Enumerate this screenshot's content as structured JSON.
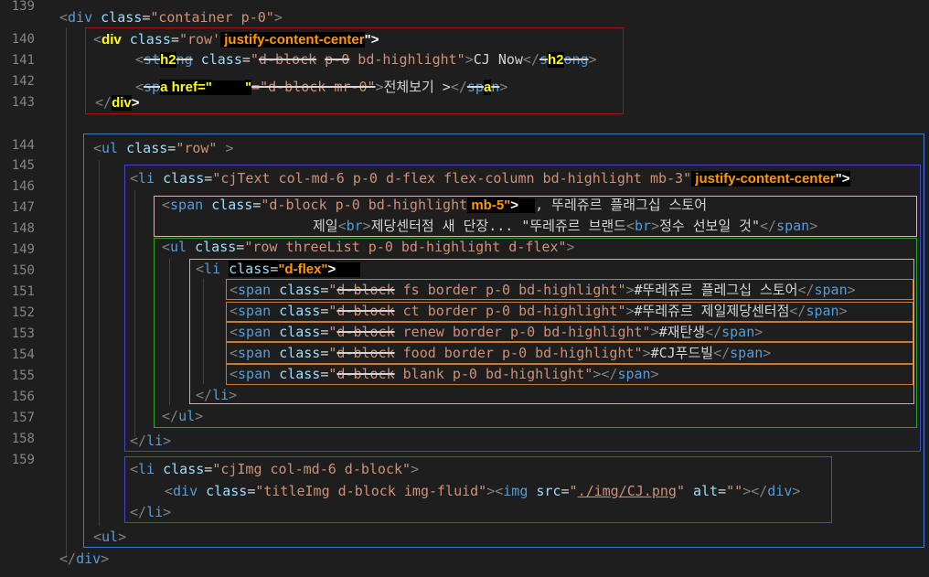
{
  "editor": {
    "line_numbers": [
      "139",
      "140",
      "141",
      "142",
      "143",
      "144",
      "145",
      "146",
      "147",
      "148",
      "149",
      "150",
      "151",
      "152",
      "153",
      "154",
      "155",
      "156",
      "157",
      "158",
      "159"
    ],
    "lines": [
      {
        "tokens": [
          {
            "t": "<",
            "c": "punct"
          },
          {
            "t": "div",
            "c": "tag"
          },
          {
            "t": " ",
            "c": "text"
          },
          {
            "t": "class",
            "c": "attr"
          },
          {
            "t": "=",
            "c": "eq"
          },
          {
            "t": "\"container p-0\"",
            "c": "str"
          },
          {
            "t": ">",
            "c": "punct"
          }
        ]
      },
      {
        "tokens": [
          {
            "t": "<",
            "c": "punct"
          },
          {
            "t": "div",
            "c": "hl-yellow"
          },
          {
            "t": " ",
            "c": "text"
          },
          {
            "t": "class",
            "c": "attr"
          },
          {
            "t": "=",
            "c": "eq"
          },
          {
            "t": "\"row'",
            "c": "str"
          },
          {
            "t": " justify-content-center",
            "c": "hl-orange blackbg"
          },
          {
            "t": "\">",
            "c": "hl-white"
          }
        ]
      },
      {
        "tokens": [
          {
            "t": "<",
            "c": "punct"
          },
          {
            "t": "st",
            "c": "tag strike"
          },
          {
            "t": "h2",
            "c": "hl-yellow blackbg"
          },
          {
            "t": "ng",
            "c": "tag strike"
          },
          {
            "t": " ",
            "c": "text"
          },
          {
            "t": "class",
            "c": "attr"
          },
          {
            "t": "=",
            "c": "eq"
          },
          {
            "t": "\"",
            "c": "str"
          },
          {
            "t": "d-block",
            "c": "str strike"
          },
          {
            "t": " ",
            "c": "str"
          },
          {
            "t": "p-0",
            "c": "str strike"
          },
          {
            "t": " bd-highlight\"",
            "c": "str"
          },
          {
            "t": ">",
            "c": "punct"
          },
          {
            "t": "CJ Now",
            "c": "text"
          },
          {
            "t": "</",
            "c": "punct"
          },
          {
            "t": "s",
            "c": "tag strike"
          },
          {
            "t": "h2",
            "c": "hl-yellow blackbg"
          },
          {
            "t": "ong",
            "c": "tag strike"
          },
          {
            "t": ">",
            "c": "punct"
          }
        ]
      },
      {
        "tokens": [
          {
            "t": "<",
            "c": "punct"
          },
          {
            "t": "sp",
            "c": "tag strike"
          },
          {
            "t": "a href=\"",
            "c": "hl-yellow blackbg"
          },
          {
            "t": "    ",
            "c": "redact"
          },
          {
            "t": "\"",
            "c": "hl-yellow blackbg"
          },
          {
            "t": "=\"d-block mr-0\"",
            "c": "str strike"
          },
          {
            "t": ">",
            "c": "punct"
          },
          {
            "t": "전체보기 >",
            "c": "text"
          },
          {
            "t": "</",
            "c": "punct"
          },
          {
            "t": "sp",
            "c": "tag strike"
          },
          {
            "t": "a",
            "c": "hl-yellow blackbg"
          },
          {
            "t": "n",
            "c": "tag strike"
          },
          {
            "t": ">",
            "c": "punct"
          }
        ]
      },
      {
        "tokens": [
          {
            "t": "</",
            "c": "punct"
          },
          {
            "t": "div",
            "c": "hl-yellow blackbg"
          },
          {
            "t": ">",
            "c": "hl-white"
          }
        ]
      },
      {
        "tokens": []
      },
      {
        "tokens": [
          {
            "t": "<",
            "c": "punct"
          },
          {
            "t": "ul",
            "c": "tag"
          },
          {
            "t": " ",
            "c": "text"
          },
          {
            "t": "class",
            "c": "attr"
          },
          {
            "t": "=",
            "c": "eq"
          },
          {
            "t": "\"row\"",
            "c": "str"
          },
          {
            "t": " >",
            "c": "punct"
          }
        ]
      },
      {
        "tokens": [
          {
            "t": "<",
            "c": "punct"
          },
          {
            "t": "li",
            "c": "tag"
          },
          {
            "t": " ",
            "c": "text"
          },
          {
            "t": "class",
            "c": "attr"
          },
          {
            "t": "=",
            "c": "eq"
          },
          {
            "t": "\"cjText col-md-6 p-0 d-flex flex-column bd-highlight mb-3\"",
            "c": "str"
          },
          {
            "t": " justify-content-center",
            "c": "hl-orange blackbg"
          },
          {
            "t": "\">",
            "c": "hl-white blackbg"
          }
        ]
      },
      {
        "tokens": [
          {
            "t": "<",
            "c": "punct"
          },
          {
            "t": "span",
            "c": "tag"
          },
          {
            "t": " ",
            "c": "text"
          },
          {
            "t": "class",
            "c": "attr"
          },
          {
            "t": "=",
            "c": "eq"
          },
          {
            "t": "\"d-block p-0 bd-highlight",
            "c": "str"
          },
          {
            "t": " mb-5\"",
            "c": "hl-orange blackbg"
          },
          {
            "t": ">",
            "c": "hl-white blackbg"
          },
          {
            "t": "  ",
            "c": "redact"
          },
          {
            "t": ", 뚜레쥬르 플래그십 스토어",
            "c": "text"
          }
        ]
      },
      {
        "tokens": [
          {
            "t": "제일",
            "c": "text"
          },
          {
            "t": "<",
            "c": "punct"
          },
          {
            "t": "br",
            "c": "tag"
          },
          {
            "t": ">",
            "c": "punct"
          },
          {
            "t": "제당센터점 새 단장... \"뚜레쥬르 브랜드",
            "c": "text"
          },
          {
            "t": "<",
            "c": "punct"
          },
          {
            "t": "br",
            "c": "tag"
          },
          {
            "t": ">",
            "c": "punct"
          },
          {
            "t": "정수 선보일 것\"",
            "c": "text"
          },
          {
            "t": "</",
            "c": "punct"
          },
          {
            "t": "span",
            "c": "tag"
          },
          {
            "t": ">",
            "c": "punct"
          }
        ]
      },
      {
        "tokens": [
          {
            "t": "<",
            "c": "punct"
          },
          {
            "t": "ul",
            "c": "tag"
          },
          {
            "t": " ",
            "c": "text"
          },
          {
            "t": "class",
            "c": "attr"
          },
          {
            "t": "=",
            "c": "eq"
          },
          {
            "t": "\"row threeList p-0 bd-highlight d-flex\"",
            "c": "str"
          },
          {
            "t": ">",
            "c": "punct"
          }
        ]
      },
      {
        "tokens": [
          {
            "t": "<",
            "c": "punct"
          },
          {
            "t": "li",
            "c": "tag"
          },
          {
            "t": " ",
            "c": "text"
          },
          {
            "t": "class",
            "c": "attr blackbg"
          },
          {
            "t": "=",
            "c": "eq blackbg"
          },
          {
            "t": "\"d-flex\"",
            "c": "hl-orange blackbg"
          },
          {
            "t": ">",
            "c": "hl-white blackbg"
          },
          {
            "t": "   ",
            "c": "redact"
          }
        ]
      },
      {
        "tokens": [
          {
            "t": "<",
            "c": "punct"
          },
          {
            "t": "span",
            "c": "tag"
          },
          {
            "t": " ",
            "c": "text"
          },
          {
            "t": "class",
            "c": "attr"
          },
          {
            "t": "=",
            "c": "eq"
          },
          {
            "t": "\"",
            "c": "str"
          },
          {
            "t": "d-block",
            "c": "str strike"
          },
          {
            "t": " fs border p-0 bd-highlight\"",
            "c": "str"
          },
          {
            "t": ">",
            "c": "punct"
          },
          {
            "t": "#뚜레쥬르 플레그십 스토어",
            "c": "text"
          },
          {
            "t": "</",
            "c": "punct"
          },
          {
            "t": "span",
            "c": "tag"
          },
          {
            "t": ">",
            "c": "punct"
          }
        ]
      },
      {
        "tokens": [
          {
            "t": "<",
            "c": "punct"
          },
          {
            "t": "span",
            "c": "tag"
          },
          {
            "t": " ",
            "c": "text"
          },
          {
            "t": "class",
            "c": "attr"
          },
          {
            "t": "=",
            "c": "eq"
          },
          {
            "t": "\"",
            "c": "str"
          },
          {
            "t": "d-block",
            "c": "str strike"
          },
          {
            "t": " ct border p-0 bd-highlight\"",
            "c": "str"
          },
          {
            "t": ">",
            "c": "punct"
          },
          {
            "t": "#뚜레쥬르 제일제당센터점",
            "c": "text"
          },
          {
            "t": "</",
            "c": "punct"
          },
          {
            "t": "span",
            "c": "tag"
          },
          {
            "t": ">",
            "c": "punct"
          }
        ]
      },
      {
        "tokens": [
          {
            "t": "<",
            "c": "punct"
          },
          {
            "t": "span",
            "c": "tag"
          },
          {
            "t": " ",
            "c": "text"
          },
          {
            "t": "class",
            "c": "attr"
          },
          {
            "t": "=",
            "c": "eq"
          },
          {
            "t": "\"",
            "c": "str"
          },
          {
            "t": "d-block",
            "c": "str strike"
          },
          {
            "t": " renew border p-0 bd-highlight\"",
            "c": "str"
          },
          {
            "t": ">",
            "c": "punct"
          },
          {
            "t": "#재탄생",
            "c": "text"
          },
          {
            "t": "</",
            "c": "punct"
          },
          {
            "t": "span",
            "c": "tag"
          },
          {
            "t": ">",
            "c": "punct"
          }
        ]
      },
      {
        "tokens": [
          {
            "t": "<",
            "c": "punct"
          },
          {
            "t": "span",
            "c": "tag"
          },
          {
            "t": " ",
            "c": "text"
          },
          {
            "t": "class",
            "c": "attr"
          },
          {
            "t": "=",
            "c": "eq"
          },
          {
            "t": "\"",
            "c": "str"
          },
          {
            "t": "d-block",
            "c": "str strike"
          },
          {
            "t": " food border p-0 bd-highlight\"",
            "c": "str"
          },
          {
            "t": ">",
            "c": "punct"
          },
          {
            "t": "#CJ푸드빌",
            "c": "text"
          },
          {
            "t": "</",
            "c": "punct"
          },
          {
            "t": "span",
            "c": "tag"
          },
          {
            "t": ">",
            "c": "punct"
          }
        ]
      },
      {
        "tokens": [
          {
            "t": "<",
            "c": "punct"
          },
          {
            "t": "span",
            "c": "tag"
          },
          {
            "t": " ",
            "c": "text"
          },
          {
            "t": "class",
            "c": "attr"
          },
          {
            "t": "=",
            "c": "eq"
          },
          {
            "t": "\"",
            "c": "str"
          },
          {
            "t": "d-block",
            "c": "str strike"
          },
          {
            "t": " blank p-0 bd-highlight\"",
            "c": "str"
          },
          {
            "t": ">",
            "c": "punct"
          },
          {
            "t": "</",
            "c": "punct"
          },
          {
            "t": "span",
            "c": "tag"
          },
          {
            "t": ">",
            "c": "punct"
          }
        ]
      },
      {
        "tokens": [
          {
            "t": "</",
            "c": "punct"
          },
          {
            "t": "li",
            "c": "tag"
          },
          {
            "t": ">",
            "c": "punct"
          }
        ]
      },
      {
        "tokens": [
          {
            "t": "</",
            "c": "punct"
          },
          {
            "t": "ul",
            "c": "tag"
          },
          {
            "t": ">",
            "c": "punct"
          }
        ]
      },
      {
        "tokens": [
          {
            "t": "</",
            "c": "punct"
          },
          {
            "t": "li",
            "c": "tag"
          },
          {
            "t": ">",
            "c": "punct"
          }
        ]
      },
      {
        "tokens": [
          {
            "t": "<",
            "c": "punct"
          },
          {
            "t": "li",
            "c": "tag"
          },
          {
            "t": " ",
            "c": "text"
          },
          {
            "t": "class",
            "c": "attr"
          },
          {
            "t": "=",
            "c": "eq"
          },
          {
            "t": "\"cjImg col-md-6 d-block\"",
            "c": "str"
          },
          {
            "t": ">",
            "c": "punct"
          }
        ]
      },
      {
        "tokens": [
          {
            "t": "<",
            "c": "punct"
          },
          {
            "t": "div",
            "c": "tag"
          },
          {
            "t": " ",
            "c": "text"
          },
          {
            "t": "class",
            "c": "attr"
          },
          {
            "t": "=",
            "c": "eq"
          },
          {
            "t": "\"titleImg d-block img-fluid\"",
            "c": "str"
          },
          {
            "t": ">",
            "c": "punct"
          },
          {
            "t": "<",
            "c": "punct"
          },
          {
            "t": "img",
            "c": "tag"
          },
          {
            "t": " ",
            "c": "text"
          },
          {
            "t": "src",
            "c": "attr"
          },
          {
            "t": "=",
            "c": "eq"
          },
          {
            "t": "\"",
            "c": "str"
          },
          {
            "t": "./img/CJ.png",
            "c": "str under"
          },
          {
            "t": "\"",
            "c": "str"
          },
          {
            "t": " ",
            "c": "text"
          },
          {
            "t": "alt",
            "c": "attr"
          },
          {
            "t": "=",
            "c": "eq"
          },
          {
            "t": "\"\"",
            "c": "str"
          },
          {
            "t": ">",
            "c": "punct"
          },
          {
            "t": "</",
            "c": "punct"
          },
          {
            "t": "div",
            "c": "tag"
          },
          {
            "t": ">",
            "c": "punct"
          }
        ]
      },
      {
        "tokens": [
          {
            "t": "</",
            "c": "punct"
          },
          {
            "t": "li",
            "c": "tag"
          },
          {
            "t": ">",
            "c": "punct"
          }
        ]
      },
      {
        "tokens": [
          {
            "t": "<",
            "c": "punct"
          },
          {
            "t": "ul",
            "c": "tag"
          },
          {
            "t": ">",
            "c": "punct"
          }
        ]
      },
      {
        "tokens": [
          {
            "t": "</",
            "c": "punct"
          },
          {
            "t": "div",
            "c": "tag"
          },
          {
            "t": ">",
            "c": "punct"
          }
        ]
      }
    ]
  },
  "colors": {
    "box_red": "#a31515",
    "box_blue": "#3b7bd6",
    "box_indigo": "#4747c2",
    "box_pink": "#d9b3c0",
    "box_green": "#2aa52a",
    "box_yellow": "#c8c832",
    "box_orange": "#c87a32"
  }
}
